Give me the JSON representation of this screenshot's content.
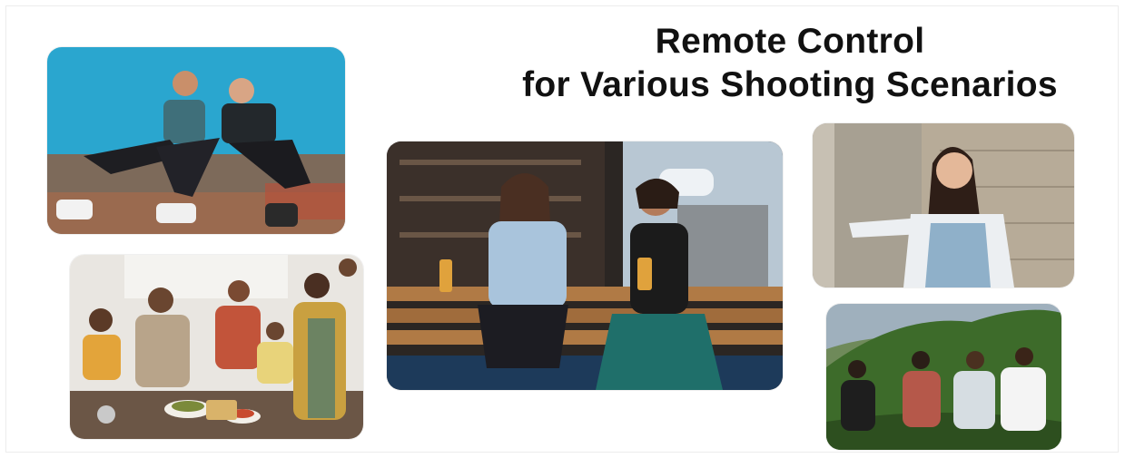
{
  "heading": {
    "line1": "Remote Control",
    "line2": "for Various Shooting Scenarios"
  },
  "colors": {
    "sky": "#2aa6cf",
    "text": "#111111",
    "bar_wood": "#b07a45",
    "teal_dress": "#1f6f6a",
    "hill_green": "#3d6b2a"
  },
  "photos": [
    {
      "id": "rooftop-couple"
    },
    {
      "id": "family-cooking"
    },
    {
      "id": "friends-at-bar"
    },
    {
      "id": "woman-by-wall"
    },
    {
      "id": "friends-on-hill"
    }
  ]
}
